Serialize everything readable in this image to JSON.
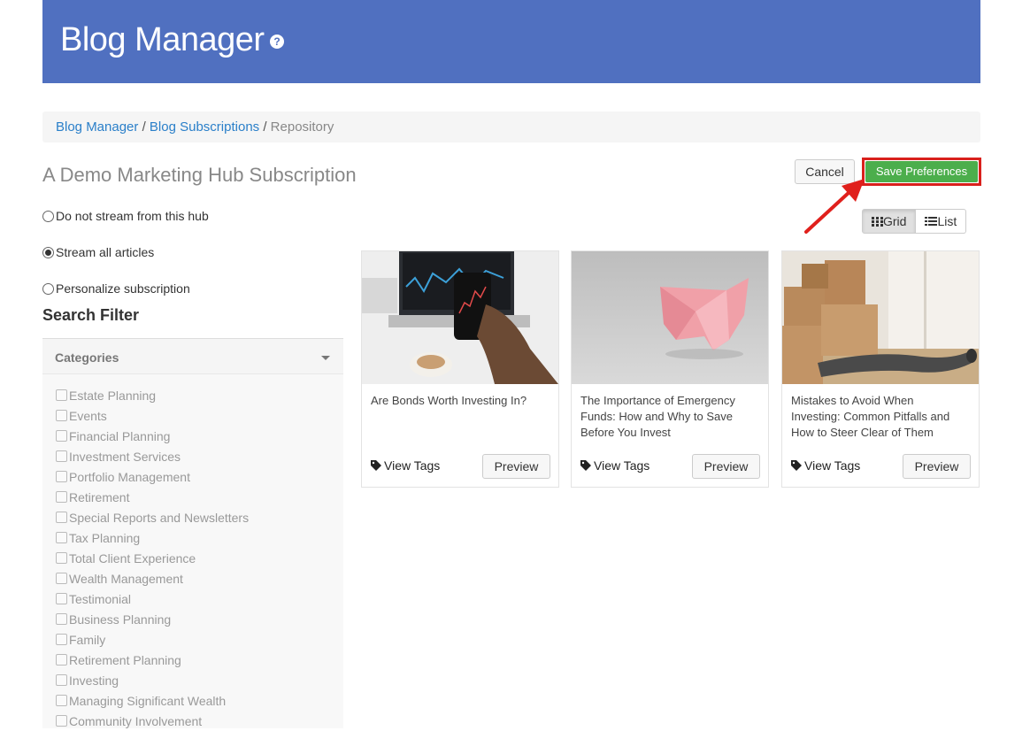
{
  "header": {
    "title": "Blog Manager",
    "help_glyph": "?"
  },
  "breadcrumb": {
    "items": [
      {
        "label": "Blog Manager"
      },
      {
        "label": "Blog Subscriptions"
      },
      {
        "label": "Repository"
      }
    ],
    "separator": "/"
  },
  "subscription": {
    "title": "A Demo Marketing Hub Subscription"
  },
  "actions": {
    "cancel_label": "Cancel",
    "save_label": "Save Preferences"
  },
  "view_toggle": {
    "grid_label": "Grid",
    "list_label": "List",
    "active": "Grid"
  },
  "stream_options": [
    {
      "label": "Do not stream from this hub",
      "checked": false
    },
    {
      "label": "Stream all articles",
      "checked": true
    },
    {
      "label": "Personalize subscription",
      "checked": false
    }
  ],
  "filter": {
    "heading": "Search Filter",
    "categories_label": "Categories",
    "categories": [
      "Estate Planning",
      "Events",
      "Financial Planning",
      "Investment Services",
      "Portfolio Management",
      "Retirement",
      "Special Reports and Newsletters",
      "Tax Planning",
      "Total Client Experience",
      "Wealth Management",
      "Testimonial",
      "Business Planning",
      "Family",
      "Retirement Planning",
      "Investing",
      "Managing Significant Wealth",
      "Community Involvement"
    ]
  },
  "articles": [
    {
      "title": "Are Bonds Worth Investing In?",
      "tags_label": "View Tags",
      "preview_label": "Preview",
      "image": "phone-stock-chart"
    },
    {
      "title": "The Importance of Emergency Funds: How and Why to Save Before You Invest",
      "tags_label": "View Tags",
      "preview_label": "Preview",
      "image": "origami-pig"
    },
    {
      "title": "Mistakes to Avoid When Investing: Common Pitfalls and How to Steer Clear of Them",
      "tags_label": "View Tags",
      "preview_label": "Preview",
      "image": "moving-boxes"
    }
  ],
  "colors": {
    "header": "#5070c0",
    "save": "#4cae4c",
    "highlight": "#d9201c",
    "link": "#2a7fc9"
  }
}
